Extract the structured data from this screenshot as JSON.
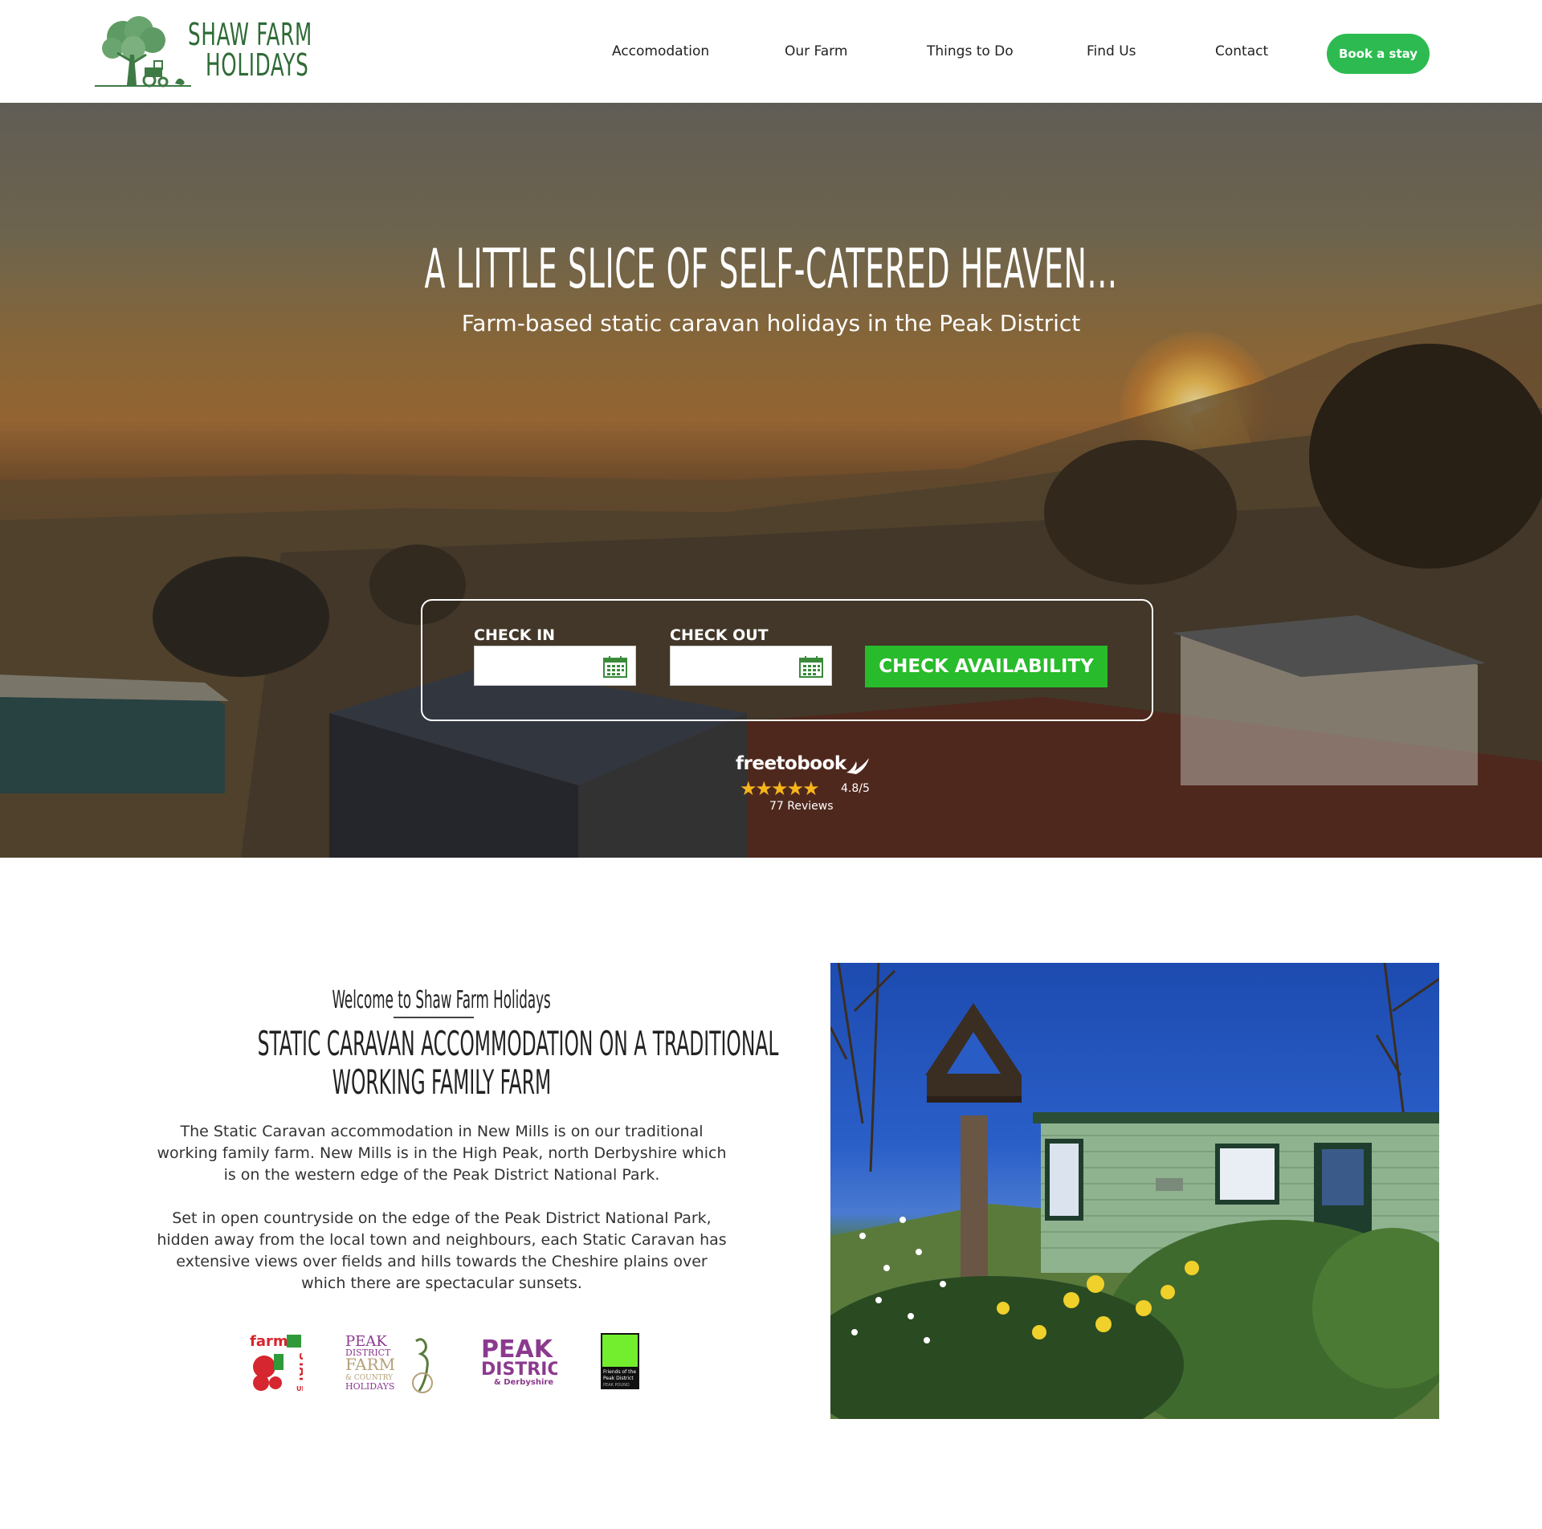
{
  "header": {
    "logo": {
      "line1": "Shaw Farm",
      "line2": "Holidays"
    },
    "nav": [
      {
        "label": "Accomodation"
      },
      {
        "label": "Our Farm"
      },
      {
        "label": "Things to Do"
      },
      {
        "label": "Find Us"
      },
      {
        "label": "Contact"
      }
    ],
    "cta_label": "Book a stay"
  },
  "hero": {
    "title": "A little slice of self-catered heaven...",
    "subtitle": "Farm-based static caravan holidays in the Peak District",
    "booking": {
      "check_in_label": "CHECK IN",
      "check_out_label": "CHECK OUT",
      "button_label": "CHECK AVAILABILITY"
    },
    "reviews": {
      "brand": "freetobook",
      "stars": "★★★★★",
      "score": "4.8/5",
      "count": "77 Reviews"
    }
  },
  "welcome": {
    "eyebrow": "Welcome to Shaw Farm Holidays",
    "title_line1": "Static caravan accommodation on a traditional",
    "title_line2": "working family farm",
    "paragraph1": "The Static Caravan accommodation in New Mills is on our traditional working family farm. New Mills is in the High Peak, north Derbyshire which is on the western edge of the Peak District National Park.",
    "paragraph2": "Set in open countryside on the edge of the Peak District National Park, hidden away from the local town and neighbours, each Static Caravan has extensive views over fields and hills towards the Cheshire plains over which there are spectacular sunsets."
  },
  "partners": [
    {
      "name": "farm-stay-uk",
      "line1": "farm",
      "line2": "STAY",
      "line3": "UK"
    },
    {
      "name": "peak-district-farm-holidays",
      "line1": "PEAK",
      "line2": "DISTRICT",
      "line3": "FARM",
      "line4": "& COUNTRY",
      "line5": "HOLIDAYS"
    },
    {
      "name": "peak-district-derbyshire",
      "line1": "PEAK",
      "line2": "DISTRICT",
      "line3": "& Derbyshire"
    },
    {
      "name": "friends-of-the-peak-district",
      "line1": "Friends of the",
      "line2": "Peak District",
      "line3": "PEAK POUND"
    }
  ],
  "colors": {
    "brand_green": "#2e6b36",
    "cta_green": "#2dbb51",
    "check_button": "#28bb2b",
    "star_gold": "#f7b51c"
  }
}
